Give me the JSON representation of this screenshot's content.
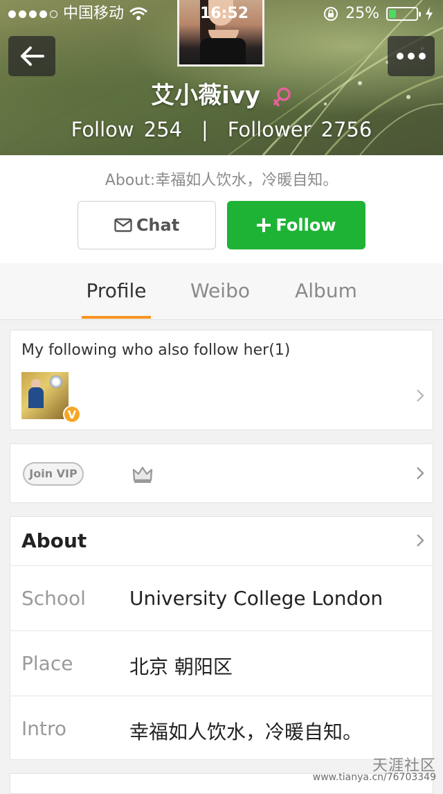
{
  "status_bar": {
    "carrier": "中国移动",
    "time": "16:52",
    "battery": "25%",
    "battery_level": 0.25
  },
  "profile": {
    "name": "艾小薇ivy",
    "follow_label": "Follow",
    "follow_count": "254",
    "separator": "|",
    "follower_label": "Follower",
    "follower_count": "2756",
    "about_line": "About:幸福如人饮水，冷暖自知。"
  },
  "actions": {
    "chat_label": "Chat",
    "follow_label": "Follow"
  },
  "tabs": [
    {
      "label": "Profile",
      "active": true
    },
    {
      "label": "Weibo",
      "active": false
    },
    {
      "label": "Album",
      "active": false
    }
  ],
  "mutual": {
    "title": "My following who also follow her(1)",
    "badge": "V"
  },
  "vip": {
    "label": "Join VIP"
  },
  "about": {
    "title": "About",
    "rows": [
      {
        "key": "School",
        "value": "University College London"
      },
      {
        "key": "Place",
        "value": "北京 朝阳区"
      },
      {
        "key": "Intro",
        "value": "幸福如人饮水，冷暖自知。"
      }
    ]
  },
  "watermark": {
    "title": "天涯社区",
    "url": "www.tianya.cn/76703349"
  },
  "colors": {
    "accent_green": "#1fb336",
    "tab_underline": "#f7941e",
    "gender_pink": "#e8609a",
    "vip_badge": "#f5a623"
  },
  "icons": [
    "back-arrow-icon",
    "more-dots-icon",
    "wifi-icon",
    "lock-rotation-icon",
    "charging-icon",
    "female-icon",
    "mail-icon",
    "plus-icon",
    "chevron-right-icon",
    "crown-icon"
  ]
}
